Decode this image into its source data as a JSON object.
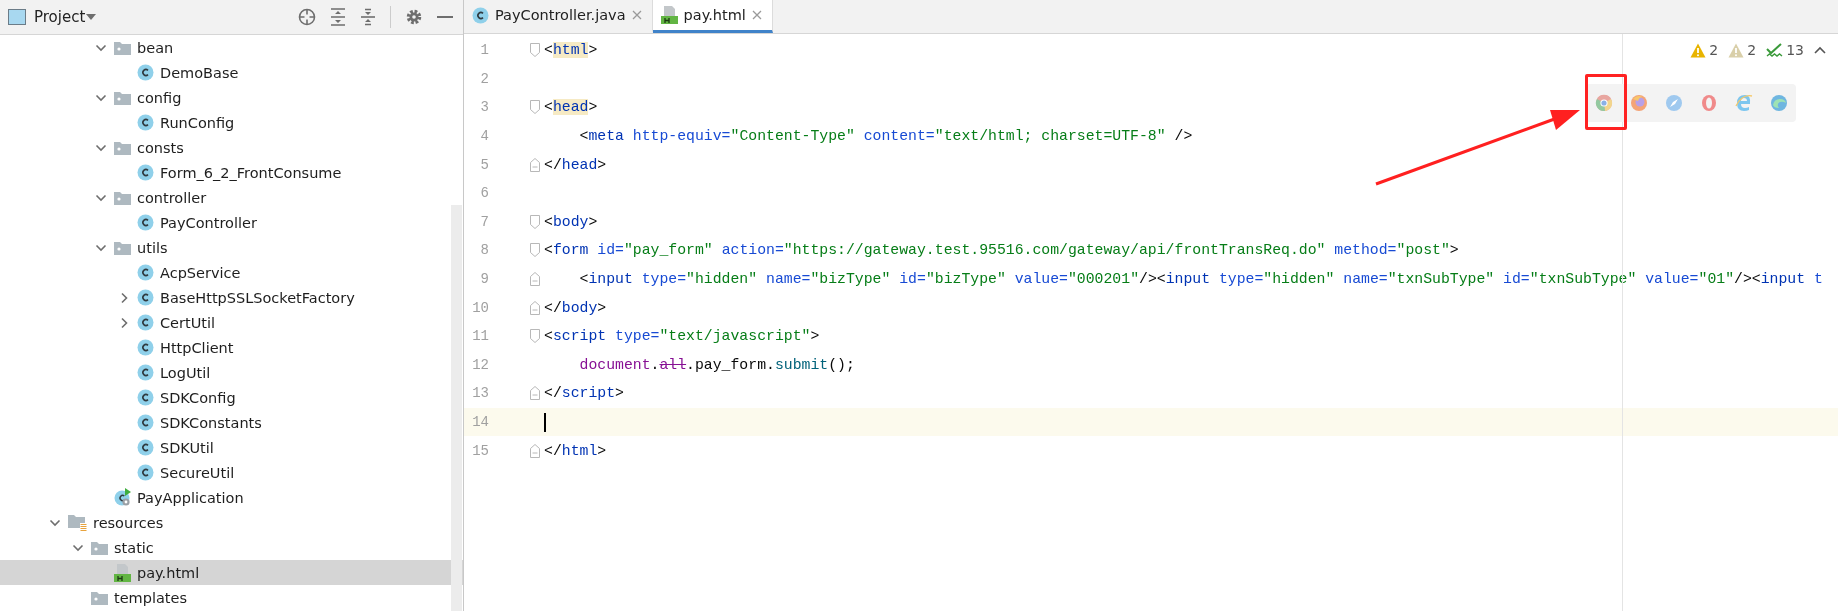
{
  "project_panel": {
    "title": "Project",
    "tree": [
      {
        "children": [
          {
            "children": [
              {
                "label": "bean",
                "kind": "folder",
                "expanded": true,
                "selected": false,
                "children": [
                  {
                    "label": "DemoBase",
                    "kind": "class",
                    "selected": false
                  }
                ]
              },
              {
                "label": "config",
                "kind": "folder",
                "expanded": true,
                "selected": false,
                "children": [
                  {
                    "label": "RunConfig",
                    "kind": "class",
                    "selected": false
                  }
                ]
              },
              {
                "label": "consts",
                "kind": "folder",
                "expanded": true,
                "selected": false,
                "children": [
                  {
                    "label": "Form_6_2_FrontConsume",
                    "kind": "class",
                    "selected": false
                  }
                ]
              },
              {
                "label": "controller",
                "kind": "folder",
                "expanded": true,
                "selected": false,
                "children": [
                  {
                    "label": "PayController",
                    "kind": "class",
                    "selected": false
                  }
                ]
              },
              {
                "label": "utils",
                "kind": "folder",
                "expanded": true,
                "selected": false,
                "children": [
                  {
                    "label": "AcpService",
                    "kind": "class",
                    "selected": false
                  },
                  {
                    "label": "BaseHttpSSLSocketFactory",
                    "kind": "class",
                    "expanded": false,
                    "selected": false
                  },
                  {
                    "label": "CertUtil",
                    "kind": "class",
                    "expanded": false,
                    "selected": false
                  },
                  {
                    "label": "HttpClient",
                    "kind": "class",
                    "selected": false
                  },
                  {
                    "label": "LogUtil",
                    "kind": "class",
                    "selected": false
                  },
                  {
                    "label": "SDKConfig",
                    "kind": "class",
                    "selected": false
                  },
                  {
                    "label": "SDKConstants",
                    "kind": "class",
                    "selected": false
                  },
                  {
                    "label": "SDKUtil",
                    "kind": "class",
                    "selected": false
                  },
                  {
                    "label": "SecureUtil",
                    "kind": "class",
                    "selected": false
                  }
                ]
              },
              {
                "label": "PayApplication",
                "kind": "app",
                "selected": false
              }
            ]
          }
        ]
      },
      {
        "label": "resources",
        "kind": "resources",
        "expanded": true,
        "selected": false,
        "children": [
          {
            "label": "static",
            "kind": "folder",
            "expanded": true,
            "selected": false,
            "children": [
              {
                "label": "pay.html",
                "kind": "html",
                "selected": true
              }
            ]
          },
          {
            "label": "templates",
            "kind": "folder",
            "selected": false
          }
        ]
      }
    ]
  },
  "tabs": [
    {
      "label": "PayController.java",
      "kind": "class",
      "selected": false
    },
    {
      "label": "pay.html",
      "kind": "html",
      "selected": true
    }
  ],
  "inspections": [
    {
      "kind": "warning",
      "count": "2"
    },
    {
      "kind": "weak-warning",
      "count": "2"
    },
    {
      "kind": "typo",
      "count": "13"
    }
  ],
  "editor_lines": [
    {
      "number": "1",
      "kind": "fold-start",
      "current": false,
      "tokens": [
        {
          "kind": "p",
          "text": "<"
        },
        {
          "kind": "tm",
          "text": "html"
        },
        {
          "kind": "p",
          "text": ">"
        }
      ]
    },
    {
      "number": "2",
      "kind": "plain",
      "current": false
    },
    {
      "number": "3",
      "kind": "fold-start",
      "current": false,
      "tokens": [
        {
          "kind": "p",
          "text": "<"
        },
        {
          "kind": "tm",
          "text": "head"
        },
        {
          "kind": "p",
          "text": ">"
        }
      ]
    },
    {
      "number": "4",
      "kind": "plain",
      "current": false,
      "tokens": [
        {
          "kind": "p",
          "text": "    <"
        },
        {
          "kind": "tag",
          "text": "meta"
        },
        {
          "kind": "attr",
          "text": " http-equiv="
        },
        {
          "kind": "val",
          "text": "\"Content-Type\""
        },
        {
          "kind": "attr",
          "text": " content="
        },
        {
          "kind": "val",
          "text": "\"text/html; charset=UTF-8\""
        },
        {
          "kind": "p",
          "text": " />"
        }
      ]
    },
    {
      "number": "5",
      "kind": "fold-end",
      "current": false,
      "tokens": [
        {
          "kind": "p",
          "text": "</"
        },
        {
          "kind": "tag",
          "text": "head"
        },
        {
          "kind": "p",
          "text": ">"
        }
      ]
    },
    {
      "number": "6",
      "kind": "plain",
      "current": false
    },
    {
      "number": "7",
      "kind": "fold-start",
      "current": false,
      "tokens": [
        {
          "kind": "p",
          "text": "<"
        },
        {
          "kind": "tag",
          "text": "body"
        },
        {
          "kind": "p",
          "text": ">"
        }
      ]
    },
    {
      "number": "8",
      "kind": "fold-start",
      "current": false,
      "tokens": [
        {
          "kind": "p",
          "text": "<"
        },
        {
          "kind": "tag",
          "text": "form"
        },
        {
          "kind": "attr",
          "text": " id="
        },
        {
          "kind": "val",
          "text": "\"pay_form\""
        },
        {
          "kind": "attr",
          "text": " action="
        },
        {
          "kind": "val",
          "text": "\"https://gateway.test.95516.com/gateway/api/frontTransReq.do\""
        },
        {
          "kind": "attr",
          "text": " method="
        },
        {
          "kind": "val",
          "text": "\"post\""
        },
        {
          "kind": "p",
          "text": ">"
        }
      ]
    },
    {
      "number": "9",
      "kind": "fold-end",
      "current": false,
      "tokens": [
        {
          "kind": "p",
          "text": "    <"
        },
        {
          "kind": "tag",
          "text": "input"
        },
        {
          "kind": "attr",
          "text": " type="
        },
        {
          "kind": "val",
          "text": "\"hidden\""
        },
        {
          "kind": "attr",
          "text": " name="
        },
        {
          "kind": "val",
          "text": "\"bizType\""
        },
        {
          "kind": "attr",
          "text": " id="
        },
        {
          "kind": "val",
          "text": "\"bizType\""
        },
        {
          "kind": "attr",
          "text": " value="
        },
        {
          "kind": "val",
          "text": "\"000201\""
        },
        {
          "kind": "p",
          "text": "/><"
        },
        {
          "kind": "tag",
          "text": "input"
        },
        {
          "kind": "attr",
          "text": " type="
        },
        {
          "kind": "val",
          "text": "\"hidden\""
        },
        {
          "kind": "attr",
          "text": " name="
        },
        {
          "kind": "val",
          "text": "\"txnSubType\""
        },
        {
          "kind": "attr",
          "text": " id="
        },
        {
          "kind": "val",
          "text": "\"txnSubType\""
        },
        {
          "kind": "attr",
          "text": " value="
        },
        {
          "kind": "val",
          "text": "\"01\""
        },
        {
          "kind": "p",
          "text": "/><"
        },
        {
          "kind": "tag",
          "text": "input"
        },
        {
          "kind": "attr",
          "text": " t"
        }
      ]
    },
    {
      "number": "10",
      "kind": "fold-end",
      "current": false,
      "tokens": [
        {
          "kind": "p",
          "text": "</"
        },
        {
          "kind": "tag",
          "text": "body"
        },
        {
          "kind": "p",
          "text": ">"
        }
      ]
    },
    {
      "number": "11",
      "kind": "fold-start",
      "current": false,
      "tokens": [
        {
          "kind": "p",
          "text": "<"
        },
        {
          "kind": "tag",
          "text": "script"
        },
        {
          "kind": "attr",
          "text": " type="
        },
        {
          "kind": "val",
          "text": "\"text/javascript\""
        },
        {
          "kind": "p",
          "text": ">"
        }
      ]
    },
    {
      "number": "12",
      "kind": "plain",
      "current": false,
      "tokens": [
        {
          "kind": "var",
          "text": "    document"
        },
        {
          "kind": "p",
          "text": "."
        },
        {
          "kind": "dep",
          "text": "all"
        },
        {
          "kind": "p",
          "text": ".pay_form."
        },
        {
          "kind": "method",
          "text": "submit"
        },
        {
          "kind": "p",
          "text": "();"
        }
      ]
    },
    {
      "number": "13",
      "kind": "fold-end",
      "current": false,
      "tokens": [
        {
          "kind": "p",
          "text": "</"
        },
        {
          "kind": "tag",
          "text": "script"
        },
        {
          "kind": "p",
          "text": ">"
        }
      ]
    },
    {
      "number": "14",
      "kind": "plain",
      "current": true
    },
    {
      "number": "15",
      "kind": "fold-end",
      "current": false,
      "tokens": [
        {
          "kind": "p",
          "text": "</"
        },
        {
          "kind": "tag",
          "text": "html"
        },
        {
          "kind": "p",
          "text": ">"
        }
      ]
    }
  ]
}
